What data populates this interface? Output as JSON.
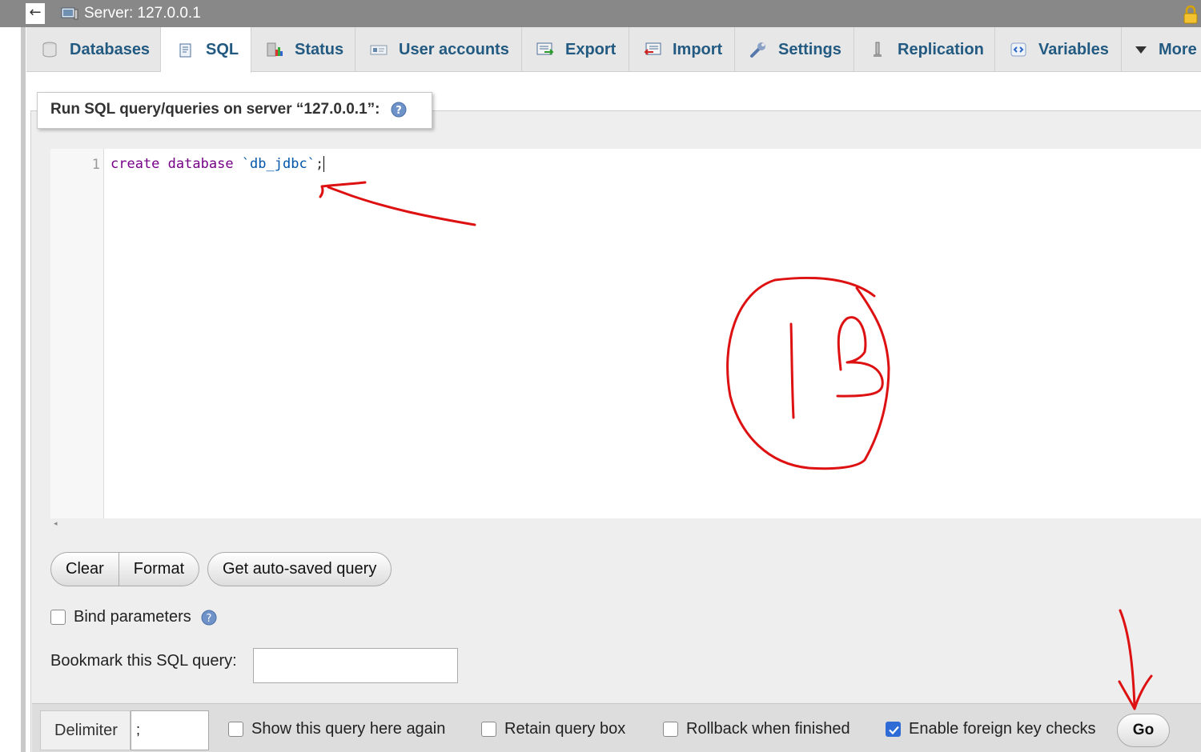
{
  "server": {
    "title": "Server: 127.0.0.1"
  },
  "tabs": [
    {
      "label": "Databases",
      "icon": "database-icon"
    },
    {
      "label": "SQL",
      "icon": "sql-icon",
      "active": true
    },
    {
      "label": "Status",
      "icon": "status-icon"
    },
    {
      "label": "User accounts",
      "icon": "user-accounts-icon"
    },
    {
      "label": "Export",
      "icon": "export-icon"
    },
    {
      "label": "Import",
      "icon": "import-icon"
    },
    {
      "label": "Settings",
      "icon": "wrench-icon"
    },
    {
      "label": "Replication",
      "icon": "replication-icon"
    },
    {
      "label": "Variables",
      "icon": "variables-icon"
    },
    {
      "label": "More",
      "icon": "caret-down-icon"
    }
  ],
  "panel": {
    "legend": "Run SQL query/queries on server “127.0.0.1”:"
  },
  "editor": {
    "line_number": "1",
    "tokens": {
      "kw1": "create",
      "kw2": "database",
      "ident": "`db_jdbc`",
      "punct": ";"
    }
  },
  "buttons": {
    "clear": "Clear",
    "format": "Format",
    "autosaved": "Get auto-saved query",
    "go": "Go"
  },
  "bind_parameters": {
    "label": "Bind parameters",
    "checked": false
  },
  "bookmark": {
    "label": "Bookmark this SQL query:",
    "value": ""
  },
  "delimiter": {
    "label": "Delimiter",
    "value": ";"
  },
  "options": [
    {
      "label": "Show this query here again",
      "checked": false
    },
    {
      "label": "Retain query box",
      "checked": false
    },
    {
      "label": "Rollback when finished",
      "checked": false
    },
    {
      "label": "Enable foreign key checks",
      "checked": true
    }
  ],
  "annotation": {
    "number": "13",
    "color": "#dd1111"
  },
  "colors": {
    "tab_text": "#235a81",
    "keyword": "#770088",
    "identifier": "#0055aa",
    "checkbox_checked": "#2e6bd6"
  }
}
